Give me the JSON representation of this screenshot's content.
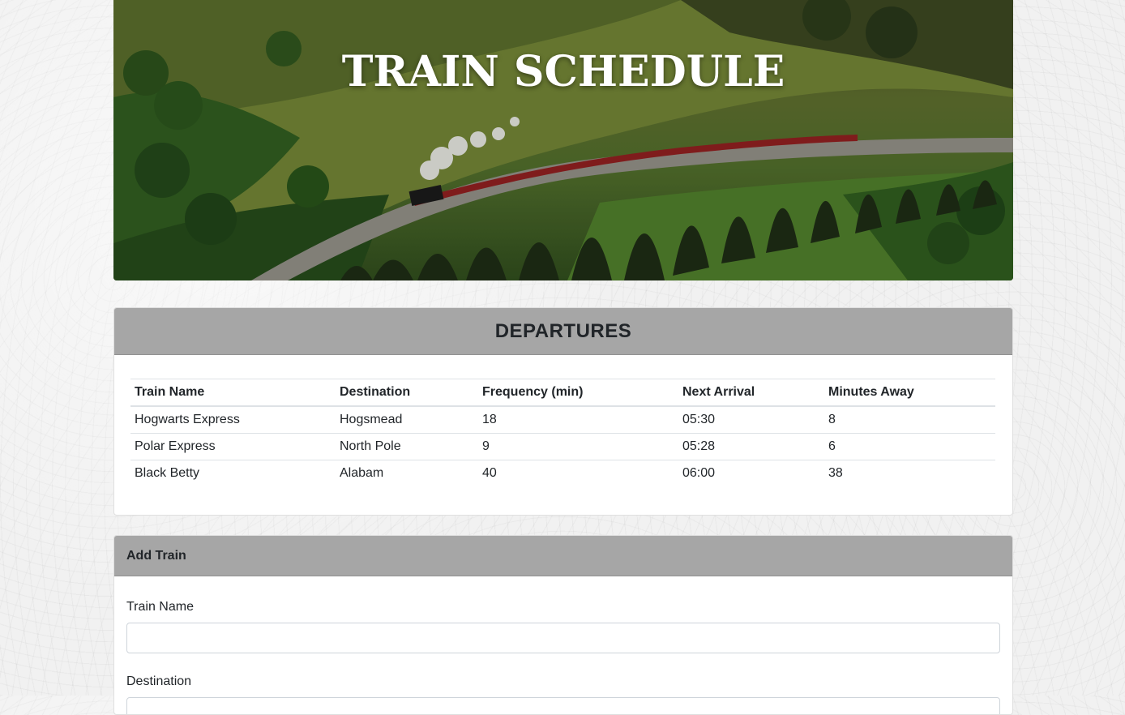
{
  "hero": {
    "title": "TRAIN SCHEDULE"
  },
  "departures": {
    "title": "DEPARTURES",
    "columns": [
      "Train Name",
      "Destination",
      "Frequency (min)",
      "Next Arrival",
      "Minutes Away"
    ],
    "rows": [
      [
        "Hogwarts Express",
        "Hogsmead",
        "18",
        "05:30",
        "8"
      ],
      [
        "Polar Express",
        "North Pole",
        "9",
        "05:28",
        "6"
      ],
      [
        "Black Betty",
        "Alabam",
        "40",
        "06:00",
        "38"
      ]
    ]
  },
  "add_train": {
    "title": "Add Train",
    "fields": [
      {
        "label": "Train Name",
        "value": "",
        "placeholder": ""
      },
      {
        "label": "Destination",
        "value": "",
        "placeholder": ""
      }
    ]
  },
  "colors": {
    "card_header": "#a6a6a6",
    "text": "#212529",
    "border": "#dee2e6"
  }
}
